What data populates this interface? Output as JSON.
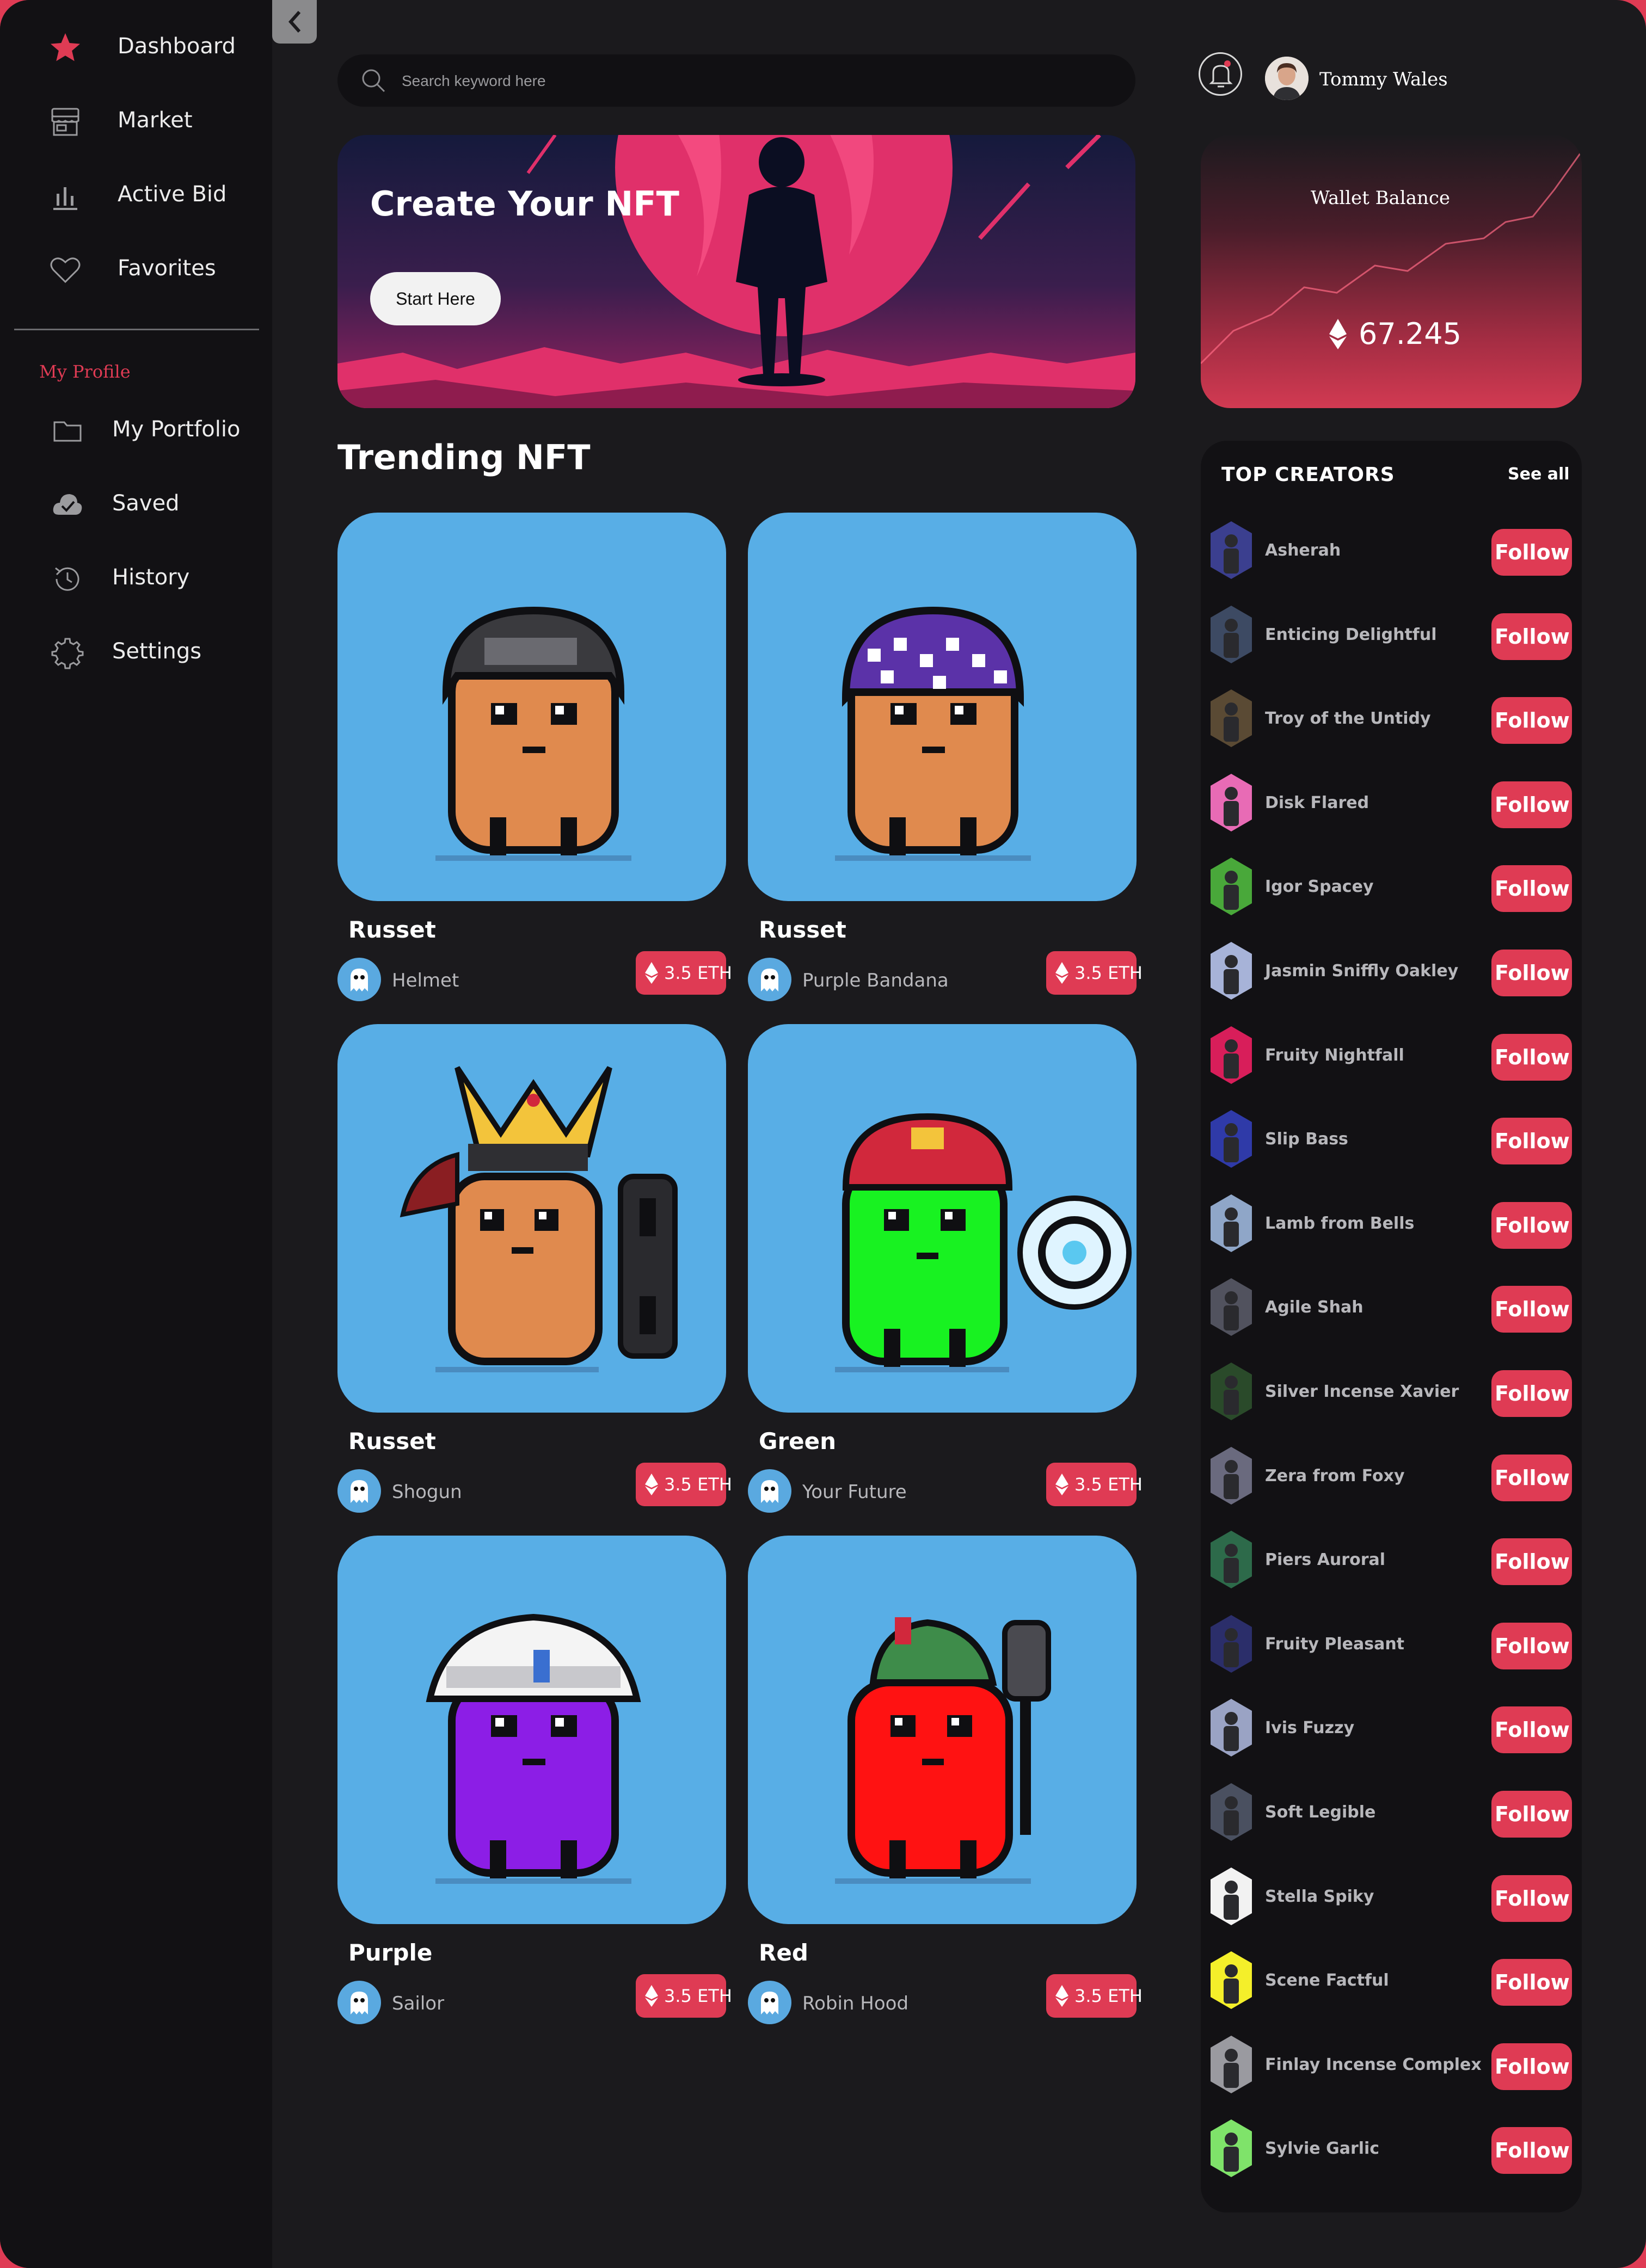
{
  "sidebar": {
    "items": [
      {
        "label": "Dashboard",
        "icon": "star-icon",
        "active": true
      },
      {
        "label": "Market",
        "icon": "store-icon"
      },
      {
        "label": "Active Bid",
        "icon": "bar-chart-icon"
      },
      {
        "label": "Favorites",
        "icon": "heart-icon"
      }
    ],
    "section_label": "My Profile",
    "profile_items": [
      {
        "label": "My Portfolio",
        "icon": "folder-icon"
      },
      {
        "label": "Saved",
        "icon": "cloud-check-icon"
      },
      {
        "label": "History",
        "icon": "history-icon"
      },
      {
        "label": "Settings",
        "icon": "gear-icon"
      }
    ]
  },
  "header": {
    "search_placeholder": "Search keyword here",
    "user_name": "Tommy Wales"
  },
  "hero": {
    "title": "Create Your NFT",
    "button_label": "Start Here"
  },
  "wallet": {
    "title": "Wallet Balance",
    "amount": "67.245"
  },
  "trending": {
    "title": "Trending NFT",
    "cards": [
      {
        "title": "Russet",
        "owner": "Helmet",
        "price": "3.5 ETH"
      },
      {
        "title": "Russet",
        "owner": "Purple Bandana",
        "price": "3.5 ETH"
      },
      {
        "title": "Russet",
        "owner": "Shogun",
        "price": "3.5 ETH"
      },
      {
        "title": "Green",
        "owner": "Your Future",
        "price": "3.5 ETH"
      },
      {
        "title": "Purple",
        "owner": "Sailor",
        "price": "3.5 ETH"
      },
      {
        "title": "Red",
        "owner": "Robin Hood",
        "price": "3.5 ETH"
      }
    ]
  },
  "creators": {
    "title": "TOP CREATORS",
    "see_all": "See all",
    "follow_label": "Follow",
    "items": [
      {
        "name": "Asherah"
      },
      {
        "name": "Enticing Delightful"
      },
      {
        "name": "Troy of the Untidy"
      },
      {
        "name": "Disk Flared"
      },
      {
        "name": "Igor Spacey"
      },
      {
        "name": "Jasmin Sniffly Oakley"
      },
      {
        "name": "Fruity Nightfall"
      },
      {
        "name": "Slip Bass"
      },
      {
        "name": "Lamb from Bells"
      },
      {
        "name": "Agile Shah"
      },
      {
        "name": "Silver Incense Xavier"
      },
      {
        "name": "Zera from Foxy"
      },
      {
        "name": "Piers Auroral"
      },
      {
        "name": "Fruity Pleasant"
      },
      {
        "name": "Ivis Fuzzy"
      },
      {
        "name": "Soft Legible"
      },
      {
        "name": "Stella Spiky"
      },
      {
        "name": "Scene Factful"
      },
      {
        "name": "Finlay Incense Complex"
      },
      {
        "name": "Sylvie Garlic"
      }
    ]
  },
  "colors": {
    "accent": "#df3b54",
    "background": "#1b1a1d",
    "sidebar": "#121114",
    "card_art": "#58aee6"
  }
}
